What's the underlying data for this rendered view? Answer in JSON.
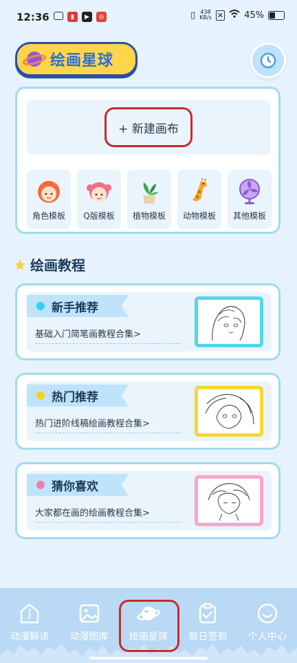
{
  "status": {
    "time": "12:36",
    "net_speed_value": "438",
    "net_speed_unit": "KB/s",
    "battery": "45%"
  },
  "header": {
    "app_title": "绘画星球"
  },
  "canvas": {
    "new_label": "+ 新建画布"
  },
  "templates": [
    {
      "label": "角色模板",
      "icon": "girl-face-icon"
    },
    {
      "label": "Q版模板",
      "icon": "chibi-girl-icon"
    },
    {
      "label": "植物模板",
      "icon": "potted-plant-icon"
    },
    {
      "label": "动物模板",
      "icon": "giraffe-icon"
    },
    {
      "label": "其他模板",
      "icon": "fan-icon"
    }
  ],
  "section": {
    "title": "绘画教程"
  },
  "tutorials": [
    {
      "title": "新手推荐",
      "subtitle": "基础入门简笔画教程合集>",
      "dot_color": "#34d3ec",
      "frame_color": "#52d7ea"
    },
    {
      "title": "热门推荐",
      "subtitle": "热门进阶线稿绘画教程合集>",
      "dot_color": "#f5d21f",
      "frame_color": "#f6d733"
    },
    {
      "title": "猜你喜欢",
      "subtitle": "大家都在画的绘画教程合集>",
      "dot_color": "#f07ab0",
      "frame_color": "#f7a6c8"
    }
  ],
  "nav": [
    {
      "label": "动漫解读",
      "icon": "info-icon",
      "active": false
    },
    {
      "label": "动漫图库",
      "icon": "image-icon",
      "active": false
    },
    {
      "label": "绘画星球",
      "icon": "planet-icon",
      "active": true
    },
    {
      "label": "每日签到",
      "icon": "clipboard-check-icon",
      "active": false
    },
    {
      "label": "个人中心",
      "icon": "smiley-icon",
      "active": false
    }
  ]
}
